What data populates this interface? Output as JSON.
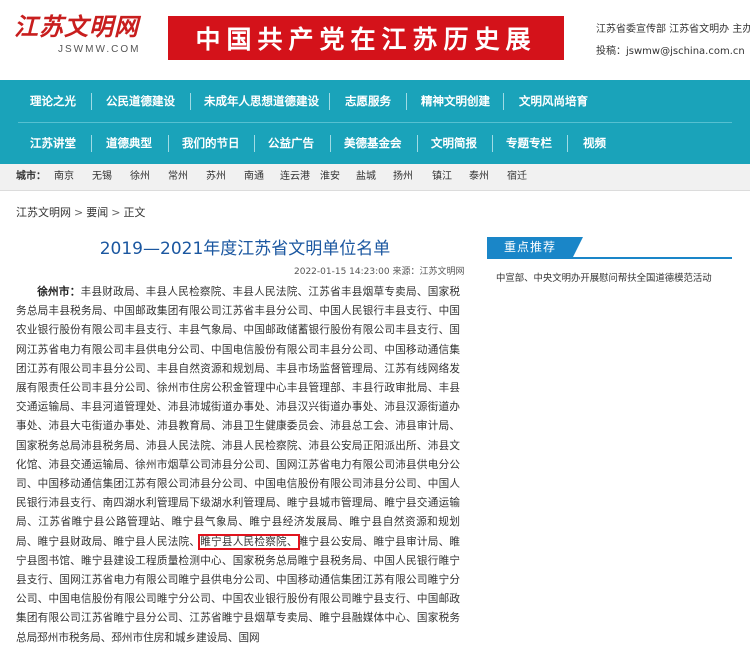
{
  "header": {
    "logo_text": "江苏文明网",
    "logo_url_text": "JSWMW.COM",
    "banner_text": "中国共产党在江苏历史展",
    "orgs": "江苏省委宣传部 江苏省文明办 主办",
    "contact": "投稿：jswmw@jschina.com.cn"
  },
  "nav": {
    "row1": [
      "理论之光",
      "公民道德建设",
      "未成年人思想道德建设",
      "志愿服务",
      "精神文明创建",
      "文明风尚培育"
    ],
    "row2": [
      "江苏讲堂",
      "道德典型",
      "我们的节日",
      "公益广告",
      "美德基金会",
      "文明简报",
      "专题专栏",
      "视频"
    ]
  },
  "citybar": {
    "label": "城市：",
    "cities": [
      "南京",
      "无锡",
      "徐州",
      "常州",
      "苏州",
      "南通",
      "连云港",
      "淮安",
      "盐城",
      "扬州",
      "镇江",
      "泰州",
      "宿迁"
    ]
  },
  "breadcrumb": {
    "items": [
      "江苏文明网",
      "要闻",
      "正文"
    ],
    "separator": ">"
  },
  "article": {
    "title": "2019—2021年度江苏省文明单位名单",
    "meta": "2022-01-15 14:23:00  来源：江苏文明网",
    "city_head": "徐州市：",
    "text_before": "丰县财政局、丰县人民检察院、丰县人民法院、江苏省丰县烟草专卖局、国家税务总局丰县税务局、中国邮政集团有限公司江苏省丰县分公司、中国人民银行丰县支行、中国农业银行股份有限公司丰县支行、丰县气象局、中国邮政储蓄银行股份有限公司丰县支行、国网江苏省电力有限公司丰县供电分公司、中国电信股份有限公司丰县分公司、中国移动通信集团江苏有限公司丰县分公司、丰县自然资源和规划局、丰县市场监督管理局、江苏有线网络发展有限责任公司丰县分公司、徐州市住房公积金管理中心丰县管理部、丰县行政审批局、丰县交通运输局、丰县河道管理处、沛县沛城街道办事处、沛县汉兴街道办事处、沛县汉源街道办事处、沛县大屯街道办事处、沛县教育局、沛县卫生健康委员会、沛县总工会、沛县审计局、国家税务总局沛县税务局、沛县人民法院、沛县人民检察院、沛县公安局正阳派出所、沛县文化馆、沛县交通运输局、徐州市烟草公司沛县分公司、国网江苏省电力有限公司沛县供电分公司、中国移动通信集团江苏有限公司沛县分公司、中国电信股份有限公司沛县分公司、中国人民银行沛县支行、南四湖水利管理局下级湖水利管理局、睢宁县城市管理局、睢宁县交通运输局、江苏省睢宁县公路管理站、睢宁县气象局、睢宁县经济发展局、睢宁县自然资源和规划局、睢宁县财政局、睢宁县人民法院、",
    "highlighted": "睢宁县人民检察院、",
    "text_after": "睢宁县公安局、睢宁县审计局、睢宁县图书馆、睢宁县建设工程质量检测中心、国家税务总局睢宁县税务局、中国人民银行睢宁县支行、国网江苏省电力有限公司睢宁县供电分公司、中国移动通信集团江苏有限公司睢宁分公司、中国电信股份有限公司睢宁分公司、中国农业银行股份有限公司睢宁县支行、中国邮政集团有限公司江苏省睢宁县分公司、江苏省睢宁县烟草专卖局、睢宁县融媒体中心、国家税务总局邳州市税务局、邳州市住房和城乡建设局、国网"
  },
  "sidebar": {
    "heading": "重点推荐",
    "item": "中宣部、中央文明办开展慰问帮扶全国道德模范活动"
  },
  "colors": {
    "nav_bg": "#1aa3ba",
    "banner_bg": "#d4121a",
    "title_blue": "#1b57a0",
    "highlight_red": "#e0141e",
    "sidebar_blue": "#1a86c8"
  }
}
